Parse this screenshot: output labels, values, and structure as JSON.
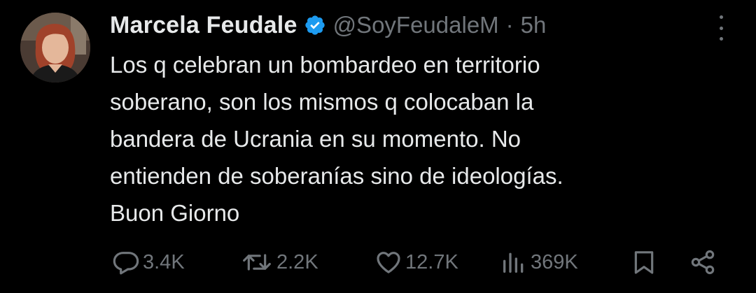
{
  "tweet": {
    "author_name": "Marcela Feudale",
    "handle": "@SoyFeudaleM",
    "separator": "·",
    "time": "5h",
    "text_lines": [
      "Los q celebran un bombardeo en territorio",
      "soberano, son los mismos q colocaban la",
      "bandera de Ucrania en su momento. No",
      "entienden de soberanías sino de ideologías.",
      "Buon Giorno"
    ],
    "verified_color": "#1d9bf0"
  },
  "actions": {
    "replies": "3.4K",
    "reposts": "2.2K",
    "likes": "12.7K",
    "views": "369K"
  },
  "icons": {
    "reply": "reply-icon",
    "repost": "repost-icon",
    "like": "heart-icon",
    "views": "views-icon",
    "bookmark": "bookmark-icon",
    "share": "share-icon",
    "more": "more-icon"
  }
}
